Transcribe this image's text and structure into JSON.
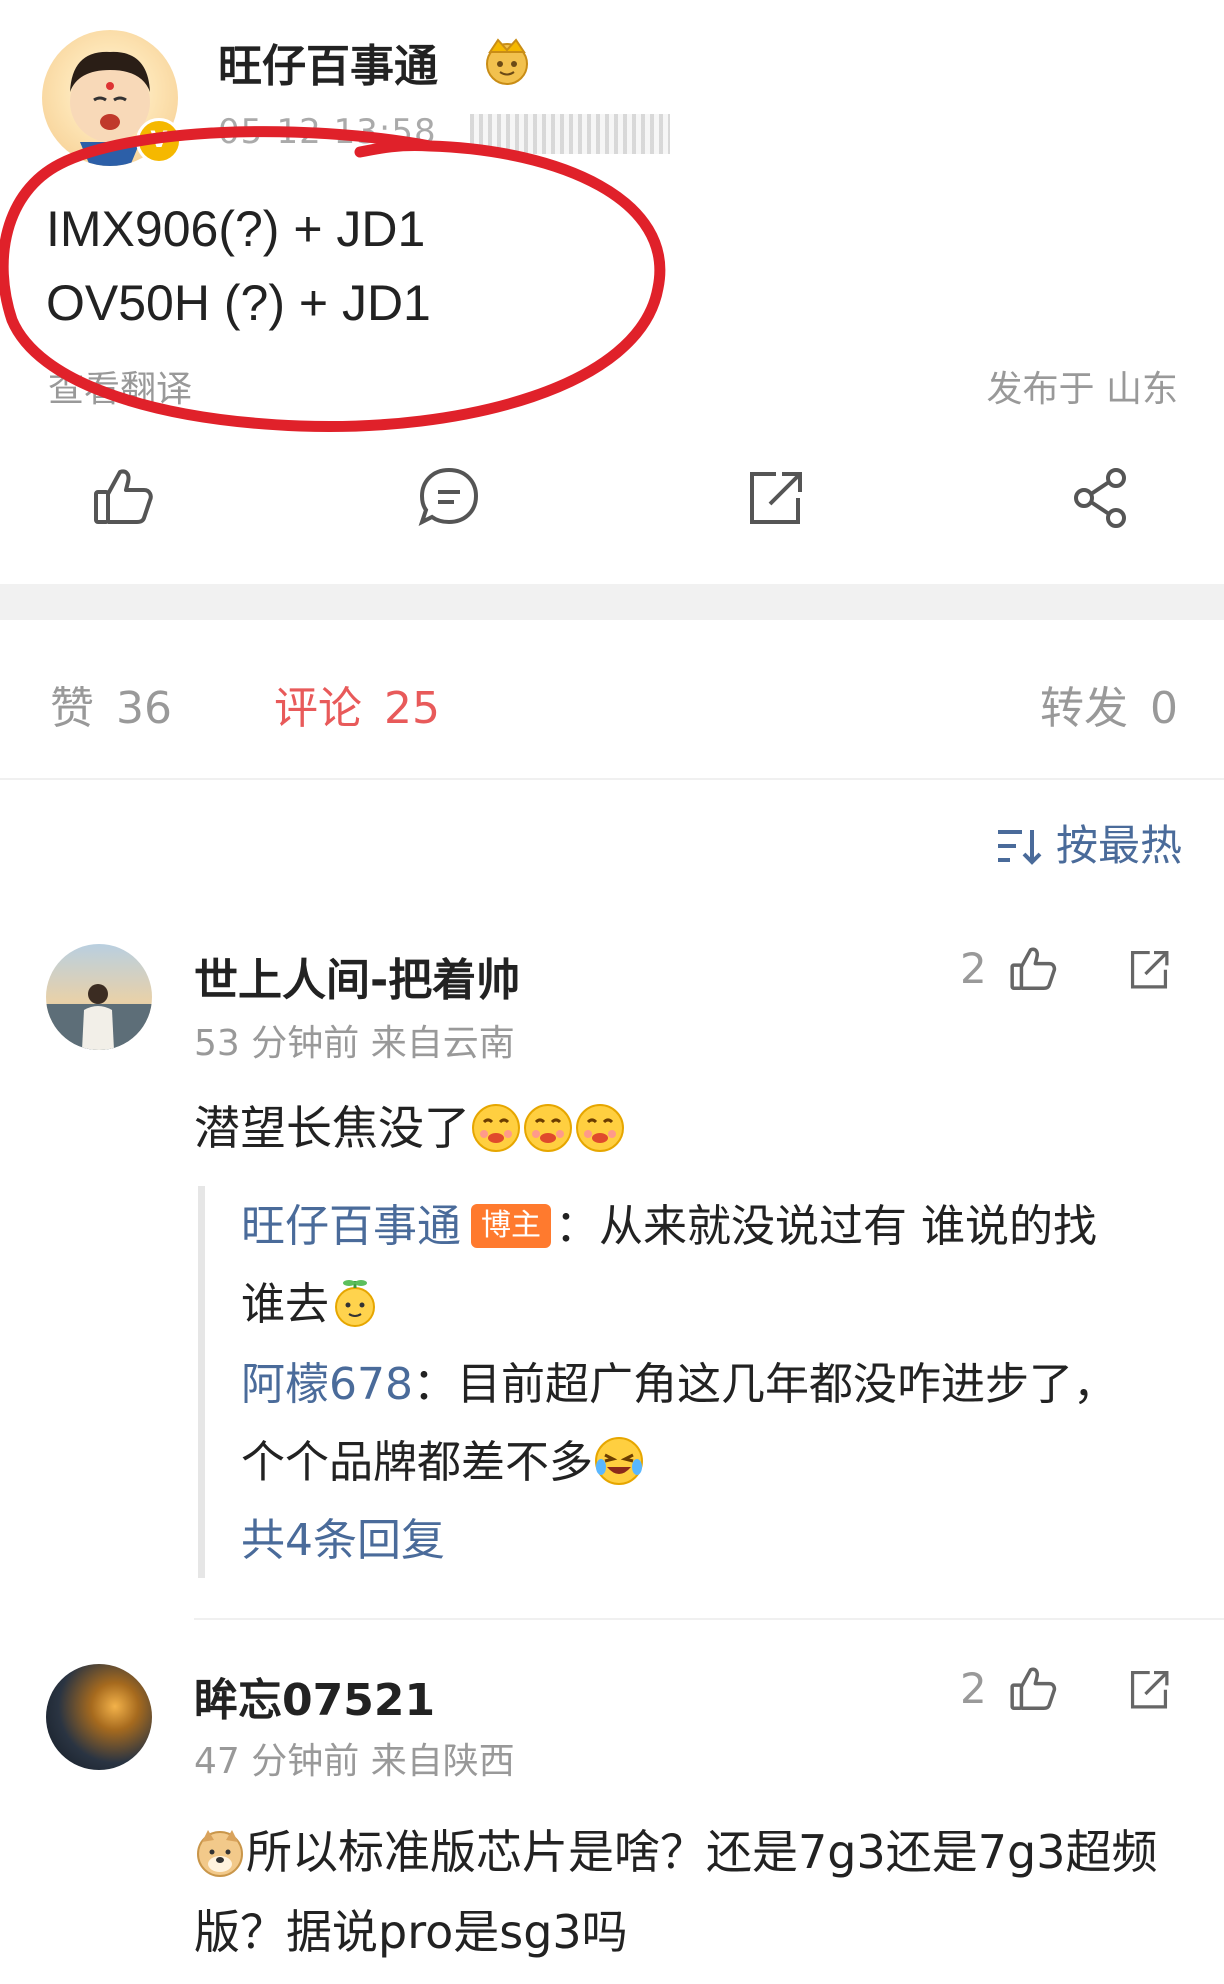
{
  "post": {
    "author": "旺仔百事通",
    "verified_badge": "V",
    "time": "05-12 13:58",
    "lines": [
      "IMX906(?) + JD1",
      "OV50H (?) + JD1"
    ],
    "translate": "查看翻译",
    "location": "发布于 山东"
  },
  "stats": {
    "like_label": "赞",
    "like_count": "36",
    "comment_label": "评论",
    "comment_count": "25",
    "repost_label": "转发",
    "repost_count": "0"
  },
  "sort": {
    "label": "按最热"
  },
  "comments": [
    {
      "name": "世上人间-把着帅",
      "meta": "53 分钟前  来自云南",
      "likes": "2",
      "text": "潜望长焦没了",
      "replies": {
        "r1_user": "旺仔百事通",
        "r1_tag": "博主",
        "r1_text_a": "：从来就没说过有 谁说的找",
        "r1_text_b": "谁去",
        "r2_user": "阿檬678",
        "r2_text_a": "：目前超广角这几年都没咋进步了，",
        "r2_text_b": "个个品牌都差不多",
        "more": "共4条回复"
      }
    },
    {
      "name": "眸忘07521",
      "meta": "47 分钟前  来自陕西",
      "likes": "2",
      "text": "所以标准版芯片是啥？还是7g3还是7g3超频版？据说pro是sg3吗"
    }
  ],
  "colors": {
    "link": "#4a6b9a",
    "accent": "#e85a5a",
    "annotation": "#e0212a",
    "tag": "#ff7a2e"
  }
}
